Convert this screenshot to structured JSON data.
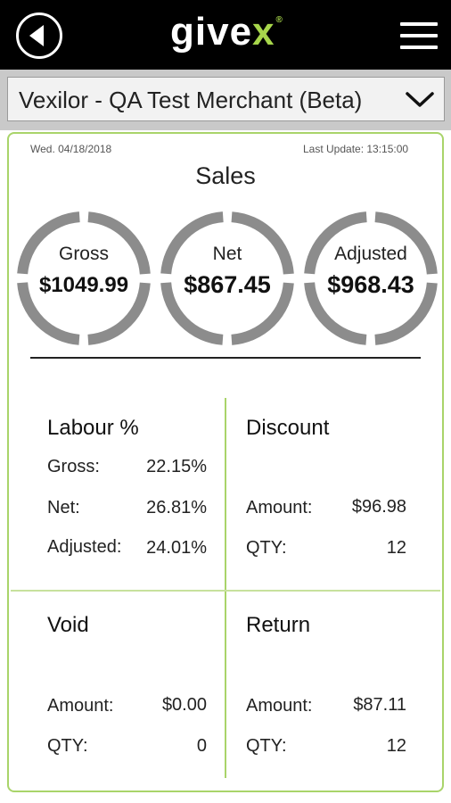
{
  "header": {
    "logo_main": "give",
    "logo_accent": "x",
    "logo_mark": "®"
  },
  "merchant_selector": {
    "label": "Vexilor - QA Test Merchant (Beta)"
  },
  "report": {
    "date": "Wed. 04/18/2018",
    "last_update": "Last Update: 13:15:00",
    "sales_title": "Sales",
    "gross": {
      "label": "Gross",
      "value": "$1049.99"
    },
    "net": {
      "label": "Net",
      "value": "$867.45"
    },
    "adjusted": {
      "label": "Adjusted",
      "value": "$968.43"
    }
  },
  "labour": {
    "title": "Labour %",
    "rows": [
      {
        "label": "Gross:",
        "value": "22.15%"
      },
      {
        "label": "Net:",
        "value": "26.81%"
      },
      {
        "label": "Adjusted:",
        "value": "24.01%"
      }
    ]
  },
  "discount": {
    "title": "Discount",
    "rows": [
      {
        "label": "Amount:",
        "value": "$96.98"
      },
      {
        "label": "QTY:",
        "value": "12"
      }
    ]
  },
  "void": {
    "title": "Void",
    "rows": [
      {
        "label": "Amount:",
        "value": "$0.00"
      },
      {
        "label": "QTY:",
        "value": "0"
      }
    ]
  },
  "return": {
    "title": "Return",
    "rows": [
      {
        "label": "Amount:",
        "value": "$87.11"
      },
      {
        "label": "QTY:",
        "value": "12"
      }
    ]
  },
  "icons": {
    "back": "back-arrow-icon",
    "menu": "hamburger-menu-icon",
    "dropdown": "chevron-down-icon"
  },
  "colors": {
    "topbar": "#000000",
    "accent": "#a7d64b",
    "ring": "#8c8c8c",
    "card_border": "#a9d46a"
  }
}
